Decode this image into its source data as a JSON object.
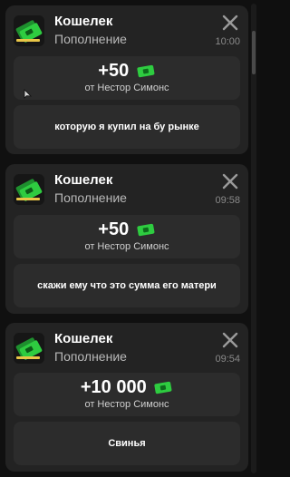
{
  "colors": {
    "card_bg": "#232323",
    "box_bg": "#2c2c2c",
    "money_green": "#2ecc40"
  },
  "notifications": [
    {
      "app_name": "Кошелек",
      "subtitle": "Пополнение",
      "time": "10:00",
      "amount": "+50",
      "from": "от Нестор Симонс",
      "message": "которую я купил на бу рынке",
      "icon": "wallet-money-icon"
    },
    {
      "app_name": "Кошелек",
      "subtitle": "Пополнение",
      "time": "09:58",
      "amount": "+50",
      "from": "от Нестор Симонс",
      "message": "скажи ему что это сумма его матери",
      "icon": "wallet-money-icon"
    },
    {
      "app_name": "Кошелек",
      "subtitle": "Пополнение",
      "time": "09:54",
      "amount": "+10 000",
      "from": "от Нестор Симонс",
      "message": "Свинья",
      "icon": "wallet-money-icon"
    }
  ]
}
